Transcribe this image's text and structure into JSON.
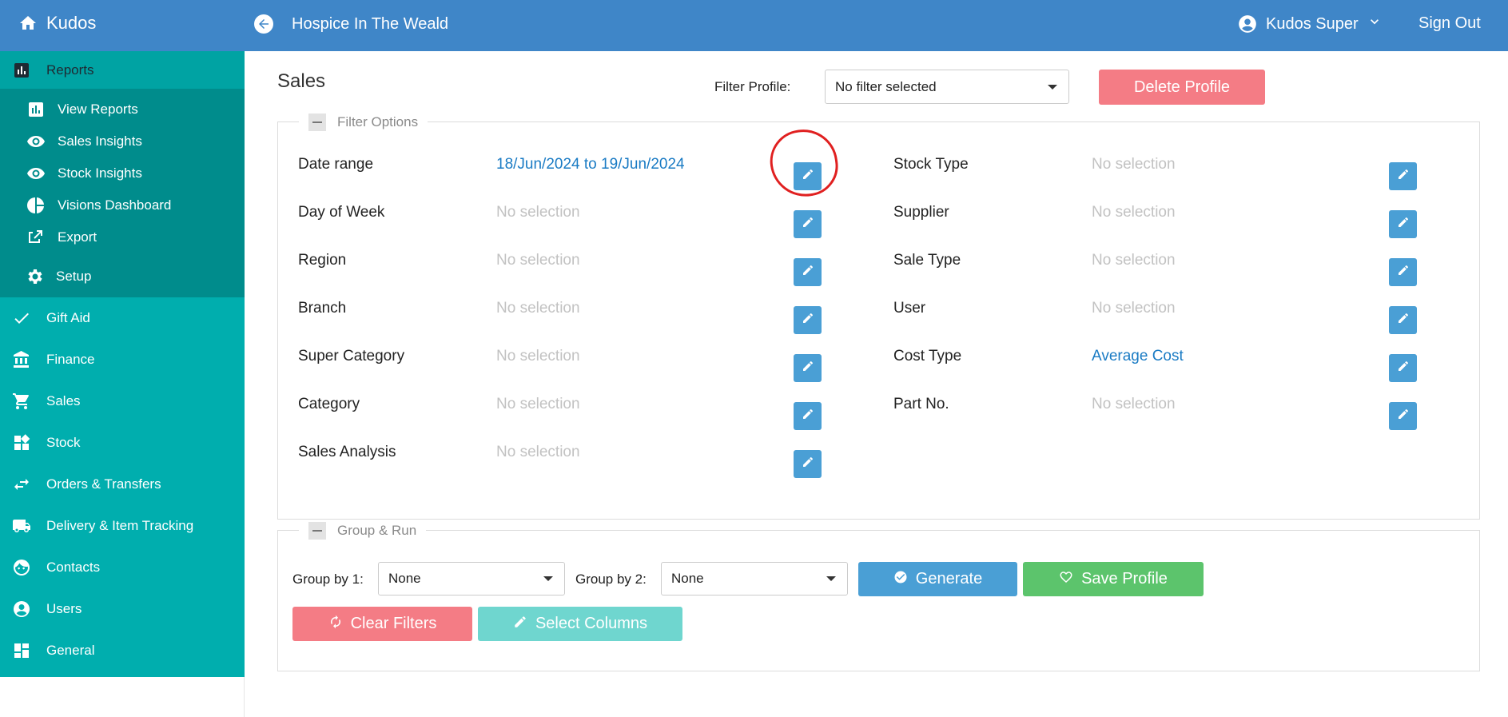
{
  "header": {
    "brand": "Kudos",
    "organisation": "Hospice In The Weald",
    "user_name": "Kudos Super",
    "sign_out": "Sign Out"
  },
  "sidebar": {
    "reports": {
      "label": "Reports",
      "items": [
        {
          "label": "View Reports",
          "icon": "bar-chart-icon"
        },
        {
          "label": "Sales Insights",
          "icon": "eye-icon"
        },
        {
          "label": "Stock Insights",
          "icon": "eye-icon"
        },
        {
          "label": "Visions Dashboard",
          "icon": "pie-chart-icon"
        },
        {
          "label": "Export",
          "icon": "export-icon"
        },
        {
          "label": "Setup",
          "icon": "gear-icon"
        }
      ]
    },
    "items": [
      {
        "label": "Gift Aid",
        "icon": "check-icon"
      },
      {
        "label": "Finance",
        "icon": "bank-icon"
      },
      {
        "label": "Sales",
        "icon": "cart-icon"
      },
      {
        "label": "Stock",
        "icon": "widgets-icon"
      },
      {
        "label": "Orders & Transfers",
        "icon": "transfer-icon"
      },
      {
        "label": "Delivery & Item Tracking",
        "icon": "truck-icon"
      },
      {
        "label": "Contacts",
        "icon": "face-icon"
      },
      {
        "label": "Users",
        "icon": "user-circle-icon"
      },
      {
        "label": "General",
        "icon": "dashboard-icon"
      }
    ]
  },
  "main": {
    "title": "Sales",
    "filter_profile_label": "Filter Profile:",
    "filter_profile_value": "No filter selected",
    "delete_profile": "Delete Profile",
    "filter_options_legend": "Filter Options",
    "left_filters": [
      {
        "label": "Date range",
        "value": "18/Jun/2024 to 19/Jun/2024",
        "set": true
      },
      {
        "label": "Day of Week",
        "value": "No selection",
        "set": false
      },
      {
        "label": "Region",
        "value": "No selection",
        "set": false
      },
      {
        "label": "Branch",
        "value": "No selection",
        "set": false
      },
      {
        "label": "Super Category",
        "value": "No selection",
        "set": false
      },
      {
        "label": "Category",
        "value": "No selection",
        "set": false
      },
      {
        "label": "Sales Analysis",
        "value": "No selection",
        "set": false
      }
    ],
    "right_filters": [
      {
        "label": "Stock Type",
        "value": "No selection",
        "set": false
      },
      {
        "label": "Supplier",
        "value": "No selection",
        "set": false
      },
      {
        "label": "Sale Type",
        "value": "No selection",
        "set": false
      },
      {
        "label": "User",
        "value": "No selection",
        "set": false
      },
      {
        "label": "Cost Type",
        "value": "Average Cost",
        "set": true
      },
      {
        "label": "Part No.",
        "value": "No selection",
        "set": false
      }
    ],
    "group_run_legend": "Group & Run",
    "group_by_1_label": "Group by 1:",
    "group_by_1_value": "None",
    "group_by_2_label": "Group by 2:",
    "group_by_2_value": "None",
    "generate": "Generate",
    "save_profile": "Save Profile",
    "clear_filters": "Clear Filters",
    "select_columns": "Select Columns"
  },
  "colors": {
    "topbar": "#3f86c8",
    "sidebar": "#00aeae",
    "sidebar_sub": "#008c8c",
    "danger": "#f47c85",
    "primary": "#4a9fd5",
    "success": "#5cc46c",
    "teal_light": "#6fd6cf",
    "annotation": "#e02020"
  }
}
